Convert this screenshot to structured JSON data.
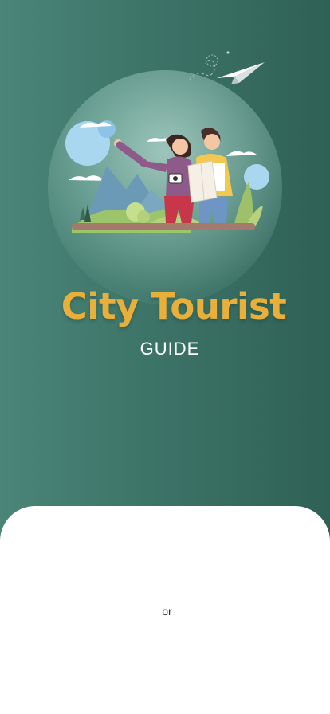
{
  "app": {
    "title": "City Tourist",
    "subtitle": "GUIDE"
  },
  "auth_sheet": {
    "divider_text": "or"
  },
  "colors": {
    "background_dark": "#2f6156",
    "background_light": "#4a8578",
    "title_accent": "#e8b03a",
    "sheet": "#ffffff"
  },
  "icons": {
    "plane": "paper-plane-icon"
  }
}
